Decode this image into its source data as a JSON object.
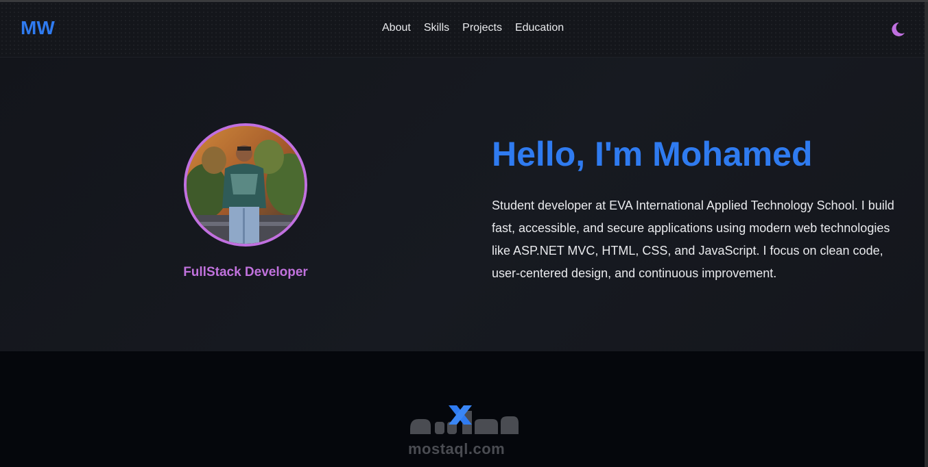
{
  "header": {
    "logo": "MW",
    "nav": [
      {
        "label": "About"
      },
      {
        "label": "Skills"
      },
      {
        "label": "Projects"
      },
      {
        "label": "Education"
      }
    ],
    "theme_icon": "moon-icon"
  },
  "hero": {
    "avatar_alt": "profile-photo",
    "role": "FullStack Developer",
    "title": "Hello, I'm Mohamed",
    "description": "Student developer at EVA International Applied Technology School. I build fast, accessible, and secure applications using modern web technologies like ASP.NET MVC, HTML, CSS, and JavaScript. I focus on clean code, user-centered design, and continuous improvement."
  },
  "watermark": {
    "text": "mostaql.com",
    "arabic": "مستقل"
  },
  "colors": {
    "accent_blue": "#2f7bf0",
    "accent_purple": "#c070e0",
    "background": "#05070c"
  }
}
